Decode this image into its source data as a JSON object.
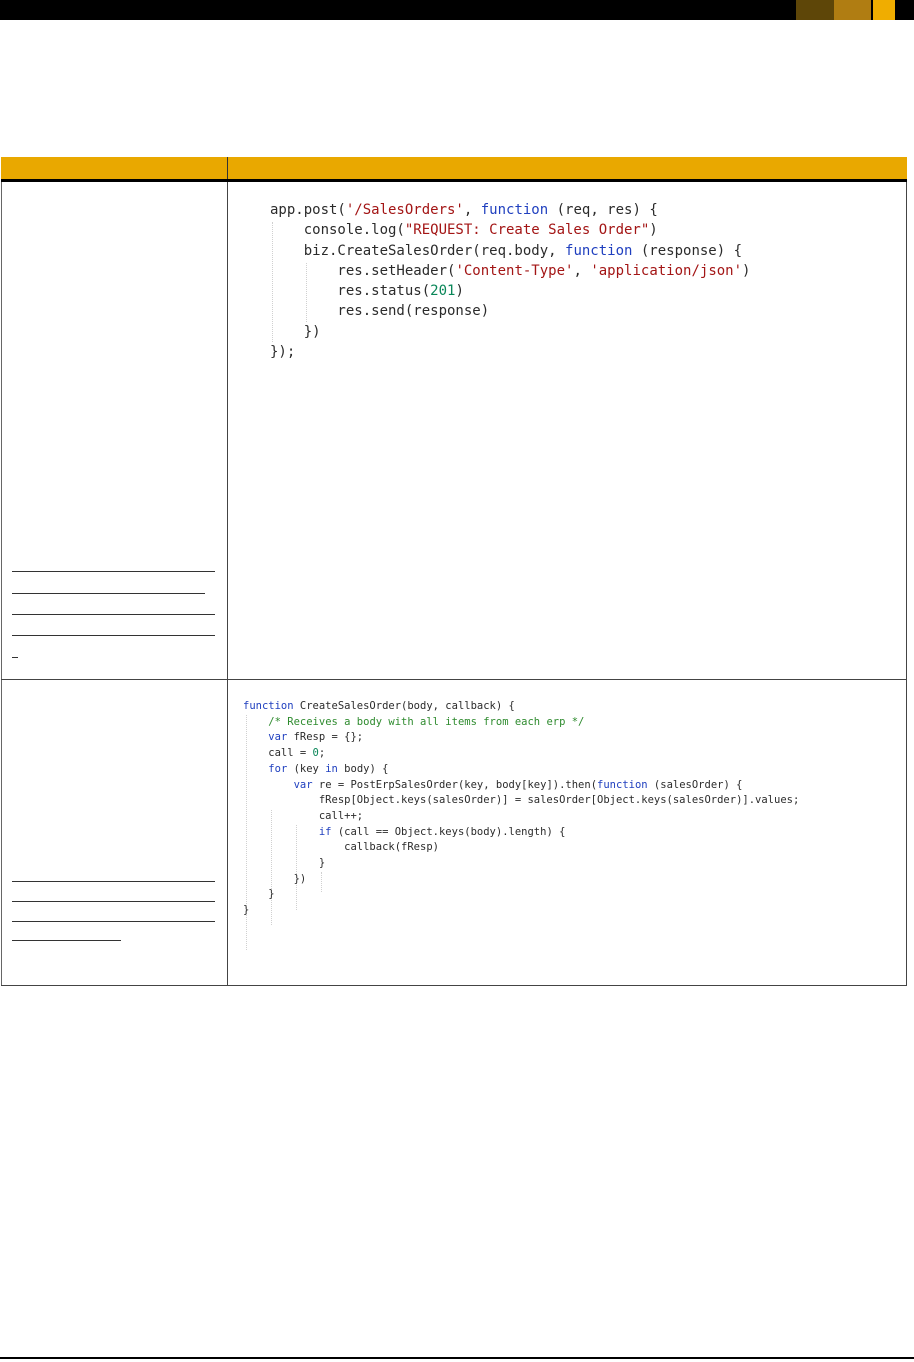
{
  "header": {
    "bar_color": "#000000",
    "swatches": [
      "#5e4608",
      "#b07d12",
      "#f0ad00"
    ]
  },
  "table": {
    "header_color": "#e9a800",
    "columns": [
      "",
      ""
    ],
    "rows": [
      {
        "code_lines": [
          "app.post('/SalesOrders', function (req, res) {",
          "    console.log(\"REQUEST: Create Sales Order\")",
          "    biz.CreateSalesOrder(req.body, function (response) {",
          "        res.setHeader('Content-Type', 'application/json')",
          "        res.status(201)",
          "        res.send(response)",
          "    })",
          "});"
        ]
      },
      {
        "code_lines": [
          "function CreateSalesOrder(body, callback) {",
          "    /* Receives a body with all items from each erp */",
          "",
          "    var fResp = {};",
          "",
          "    call = 0;",
          "    for (key in body) {",
          "        var re = PostErpSalesOrder(key, body[key]).then(function (salesOrder) {",
          "            fResp[Object.keys(salesOrder)] = salesOrder[Object.keys(salesOrder)].values;",
          "            call++;",
          "            if (call == Object.keys(body).length) {",
          "                callback(fResp)",
          "            }",
          "        })",
          "    }",
          "",
          "}"
        ]
      }
    ]
  }
}
